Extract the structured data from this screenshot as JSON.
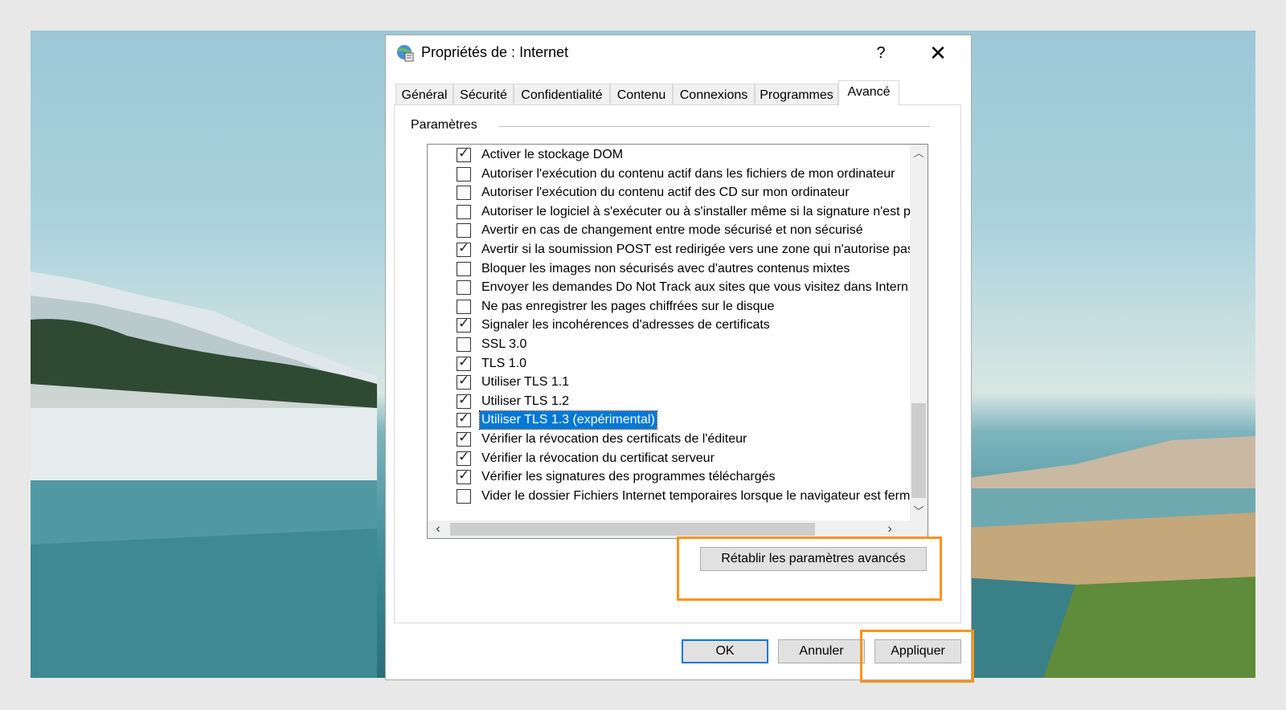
{
  "window": {
    "title": "Propriétés de : Internet",
    "help_label": "?",
    "close_label": "✕"
  },
  "tabs": [
    {
      "label": "Général"
    },
    {
      "label": "Sécurité"
    },
    {
      "label": "Confidentialité"
    },
    {
      "label": "Contenu"
    },
    {
      "label": "Connexions"
    },
    {
      "label": "Programmes"
    },
    {
      "label": "Avancé",
      "active": true
    }
  ],
  "settings": {
    "group_label": "Paramètres",
    "items": [
      {
        "label": "Activer le stockage DOM",
        "checked": true
      },
      {
        "label": "Autoriser l'exécution du contenu actif dans les fichiers de mon ordinateur",
        "checked": false
      },
      {
        "label": "Autoriser l'exécution du contenu actif des CD sur mon ordinateur",
        "checked": false
      },
      {
        "label": "Autoriser le logiciel à s'exécuter ou à s'installer même si la signature n'est pa",
        "checked": false
      },
      {
        "label": "Avertir en cas de changement entre mode sécurisé et non sécurisé",
        "checked": false
      },
      {
        "label": "Avertir si la soumission POST est redirigée vers une zone qui n'autorise pas",
        "checked": true
      },
      {
        "label": "Bloquer les images non sécurisés avec d'autres contenus mixtes",
        "checked": false
      },
      {
        "label": "Envoyer les demandes Do Not Track aux sites que vous visitez dans Intern",
        "checked": false
      },
      {
        "label": "Ne pas enregistrer les pages chiffrées sur le disque",
        "checked": false
      },
      {
        "label": "Signaler les incohérences d'adresses de certificats",
        "checked": true
      },
      {
        "label": "SSL 3.0",
        "checked": false
      },
      {
        "label": "TLS 1.0",
        "checked": true
      },
      {
        "label": "Utiliser TLS 1.1",
        "checked": true
      },
      {
        "label": "Utiliser TLS 1.2",
        "checked": true
      },
      {
        "label": "Utiliser TLS 1.3 (expérimental)",
        "checked": true,
        "selected": true
      },
      {
        "label": "Vérifier la révocation des certificats de l'éditeur",
        "checked": true
      },
      {
        "label": "Vérifier la révocation du certificat serveur",
        "checked": true
      },
      {
        "label": "Vérifier les signatures des programmes téléchargés",
        "checked": true
      },
      {
        "label": "Vider le dossier Fichiers Internet temporaires lorsque le navigateur est ferm",
        "checked": false
      }
    ],
    "reset_label": "Rétablir les paramètres avancés"
  },
  "footer": {
    "ok_label": "OK",
    "cancel_label": "Annuler",
    "apply_label": "Appliquer"
  },
  "colors": {
    "highlight": "#f7941d",
    "selection": "#0078d7"
  },
  "icons": {
    "app": "internet-options-icon",
    "checkmark": "✓",
    "scroll_up": "︿",
    "scroll_down": "﹀",
    "scroll_left": "‹",
    "scroll_right": "›"
  }
}
